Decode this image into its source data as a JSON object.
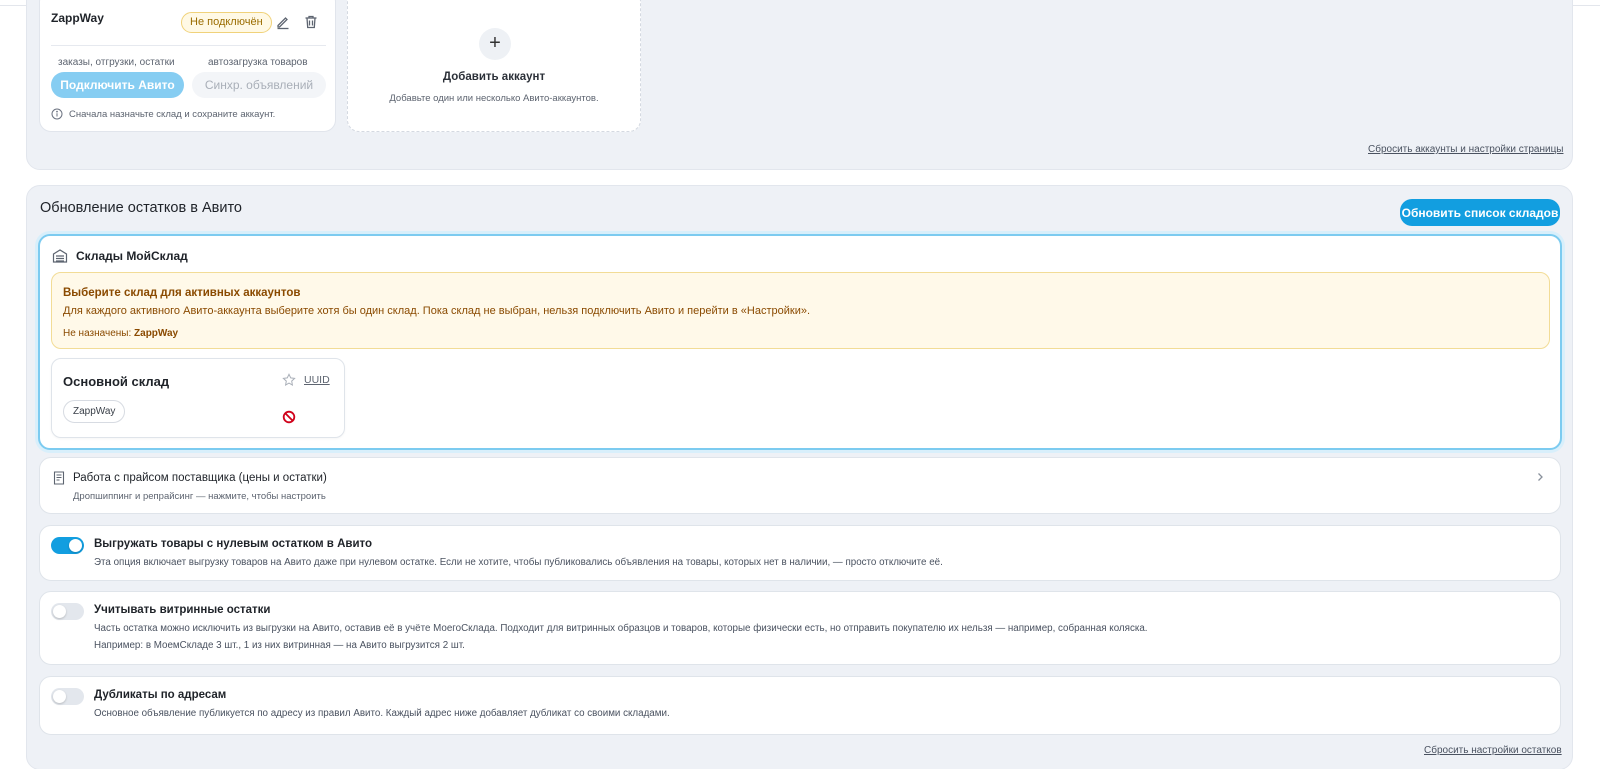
{
  "accounts_section": {
    "account": {
      "name": "ZappWay",
      "status": "Не подключён",
      "caption_left": "заказы, отгрузки, остатки",
      "caption_right": "автозагрузка товаров",
      "connect_label": "Подключить Авито",
      "sync_label": "Синхр. объявлений",
      "hint": "Сначала назначьте склад и сохраните аккаунт."
    },
    "add_account": {
      "plus": "+",
      "title": "Добавить аккаунт",
      "subtitle": "Добавьте один или несколько Авито-аккаунтов."
    },
    "reset_link": "Сбросить аккаунты и настройки страницы"
  },
  "stock_section": {
    "title": "Обновление остатков в Авито",
    "refresh_button": "Обновить список складов",
    "warehouses_panel": {
      "title": "Склады МойСклад",
      "alert": {
        "title": "Выберите склад для активных аккаунтов",
        "text": "Для каждого активного Авито-аккаунта выберите хотя бы один склад. Пока склад не выбран, нельзя подключить Авито и перейти в «Настройки».",
        "unassigned_label": "Не назначены:",
        "unassigned_value": "ZappWay"
      },
      "warehouse": {
        "name": "Основной склад",
        "uuid_label": "UUID",
        "chip": "ZappWay"
      }
    },
    "supplier_price": {
      "title": "Работа с прайсом поставщика (цены и остатки)",
      "subtitle": "Дропшиппинг и репрайсинг — нажмите, чтобы настроить"
    },
    "toggles": [
      {
        "title": "Выгружать товары с нулевым остатком в Авито",
        "desc": "Эта опция включает выгрузку товаров на Авито даже при нулевом остатке. Если не хотите, чтобы публиковались объявления на товары, которых нет в наличии, — просто отключите её.",
        "on": true
      },
      {
        "title": "Учитывать витринные остатки",
        "desc": "Часть остатка можно исключить из выгрузки на Авито, оставив её в учёте МоегоСклада. Подходит для витринных образцов и товаров, которые физически есть, но отправить покупателю их нельзя — например, собранная коляска.",
        "desc2": "Например: в МоемСкладе 3 шт., 1 из них витринная — на Авито выгрузится 2 шт.",
        "on": false
      },
      {
        "title": "Дубликаты по адресам",
        "desc": "Основное объявление публикуется по адресу из правил Авито. Каждый адрес ниже добавляет дубликат со своими складами.",
        "on": false
      }
    ],
    "reset_link": "Сбросить настройки остатков"
  },
  "colors": {
    "accent": "#129ee0",
    "connect_disabled": "#86cdf2",
    "warning_text": "#8a4a00",
    "warning_bg": "#fff9e9",
    "ban": "#d0021b"
  }
}
